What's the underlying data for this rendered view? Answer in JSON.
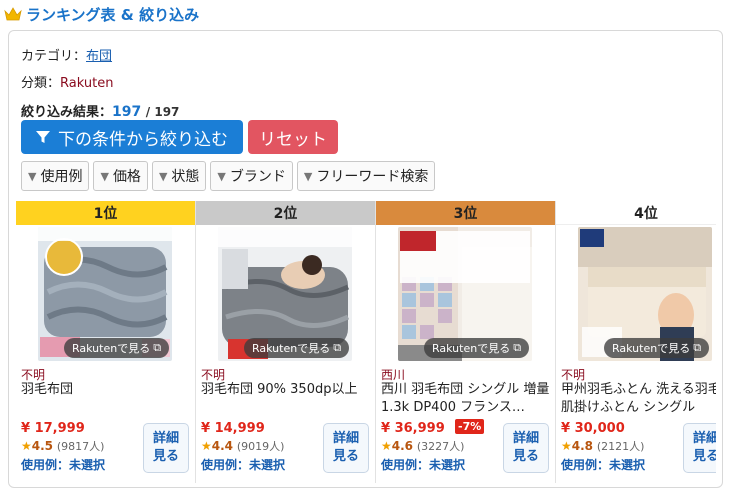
{
  "header": {
    "title": "ランキング表 & 絞り込み",
    "icon": "crown-icon"
  },
  "meta": {
    "category_label": "カテゴリ：",
    "category_value": "布団",
    "class_label": "分類：",
    "class_value": "Rakuten"
  },
  "result": {
    "label": "絞り込み結果：",
    "count": "197",
    "total": "/ 197"
  },
  "buttons": {
    "filter_label": "下の条件から絞り込む",
    "reset_label": "リセット"
  },
  "chips": [
    "使用例",
    "価格",
    "状態",
    "ブランド",
    "フリーワード検索"
  ],
  "colors": {
    "accent": "#1b7ed6",
    "reset": "#e25561",
    "price": "#e0261a",
    "gold": "#ffd21f",
    "silver": "#c9c9c9",
    "bronze": "#d98a3d"
  },
  "rakuten_badge": "Rakutenで見る",
  "detail_label": [
    "詳細",
    "見る"
  ],
  "products": [
    {
      "rank": "1位",
      "brand": "不明",
      "name": "羽毛布団",
      "price": "¥ 17,999",
      "discount": "",
      "rating": "4.5",
      "reviews": "(9817人)",
      "usage": "使用例：未選択"
    },
    {
      "rank": "2位",
      "brand": "不明",
      "name": "羽毛布団 90% 350dp以上",
      "price": "¥ 14,999",
      "discount": "",
      "rating": "4.4",
      "reviews": "(9019人)",
      "usage": "使用例：未選択"
    },
    {
      "rank": "3位",
      "brand": "西川",
      "name": "西川 羽毛布団 シングル 増量1.3k DP400 フランス…",
      "price": "¥ 36,999",
      "discount": "-7%",
      "rating": "4.6",
      "reviews": "(3227人)",
      "usage": "使用例：未選択"
    },
    {
      "rank": "4位",
      "brand": "不明",
      "name": "甲州羽毛ふとん 洗える羽毛肌掛けふとん シングル",
      "price": "¥ 30,000",
      "discount": "",
      "rating": "4.8",
      "reviews": "(2121人)",
      "usage": "使用例：未選択"
    }
  ]
}
